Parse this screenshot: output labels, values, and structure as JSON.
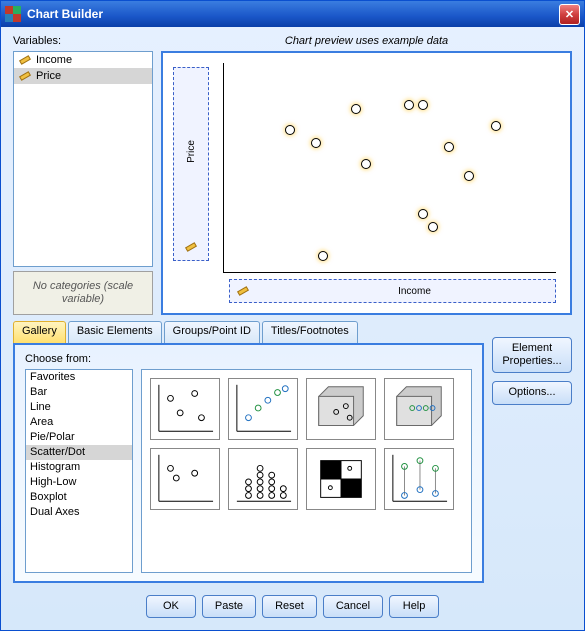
{
  "window": {
    "title": "Chart Builder"
  },
  "variables": {
    "label": "Variables:",
    "items": [
      {
        "name": "Income",
        "selected": false
      },
      {
        "name": "Price",
        "selected": true
      }
    ],
    "no_categories": "No categories (scale variable)"
  },
  "preview": {
    "title": "Chart preview uses example data",
    "y_axis_var": "Price",
    "x_axis_var": "Income"
  },
  "tabs": {
    "items": [
      {
        "label": "Gallery",
        "active": true
      },
      {
        "label": "Basic Elements",
        "active": false
      },
      {
        "label": "Groups/Point ID",
        "active": false
      },
      {
        "label": "Titles/Footnotes",
        "active": false
      }
    ],
    "choose_label": "Choose from:",
    "types": [
      "Favorites",
      "Bar",
      "Line",
      "Area",
      "Pie/Polar",
      "Scatter/Dot",
      "Histogram",
      "High-Low",
      "Boxplot",
      "Dual Axes"
    ],
    "selected_type": "Scatter/Dot"
  },
  "side_buttons": {
    "element_props": "Element Properties...",
    "options": "Options..."
  },
  "bottom_buttons": {
    "ok": "OK",
    "paste": "Paste",
    "reset": "Reset",
    "cancel": "Cancel",
    "help": "Help"
  },
  "chart_data": {
    "type": "scatter",
    "title": "Chart preview uses example data",
    "xlabel": "Income",
    "ylabel": "Price",
    "note": "example data only; values are relative positions (0-1) in the preview area",
    "points": [
      {
        "x": 0.2,
        "y": 0.68
      },
      {
        "x": 0.28,
        "y": 0.62
      },
      {
        "x": 0.4,
        "y": 0.78
      },
      {
        "x": 0.43,
        "y": 0.52
      },
      {
        "x": 0.56,
        "y": 0.8
      },
      {
        "x": 0.6,
        "y": 0.8
      },
      {
        "x": 0.6,
        "y": 0.28
      },
      {
        "x": 0.63,
        "y": 0.22
      },
      {
        "x": 0.68,
        "y": 0.6
      },
      {
        "x": 0.74,
        "y": 0.46
      },
      {
        "x": 0.82,
        "y": 0.7
      },
      {
        "x": 0.3,
        "y": 0.08
      }
    ]
  }
}
